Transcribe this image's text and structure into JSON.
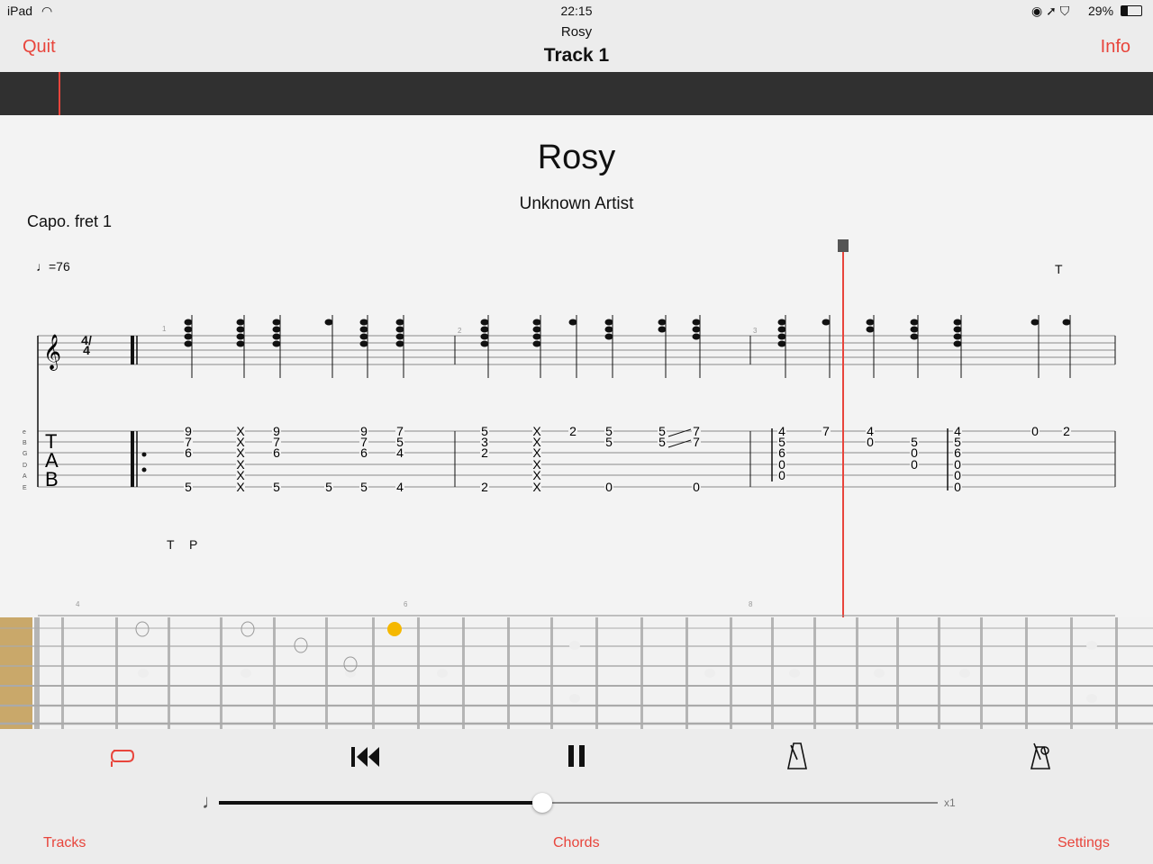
{
  "status_bar": {
    "device": "iPad",
    "time": "22:15",
    "battery": "29%"
  },
  "nav": {
    "quit": "Quit",
    "info": "Info",
    "subtitle": "Rosy",
    "title": "Track 1"
  },
  "score": {
    "title": "Rosy",
    "artist": "Unknown Artist",
    "capo": "Capo. fret 1",
    "tempo": "♩=76",
    "technique_marks": [
      "T",
      "T",
      "P"
    ],
    "measure_numbers": [
      "1",
      "2",
      "3",
      "4",
      "6",
      "8"
    ],
    "time_signature": "4/4",
    "tab_clef": [
      "T",
      "A",
      "B"
    ],
    "string_names": [
      "e",
      "B",
      "G",
      "D",
      "A",
      "E"
    ],
    "tab_columns": [
      [
        "9",
        "7",
        "6",
        "",
        "",
        "5"
      ],
      [
        "X",
        "X",
        "X",
        "X",
        "X",
        "X"
      ],
      [
        "9",
        "7",
        "6",
        "",
        "",
        "5"
      ],
      [
        "",
        "",
        "",
        "",
        "",
        "5"
      ],
      [
        "9",
        "7",
        "6",
        "",
        "",
        "5"
      ],
      [
        "7",
        "5",
        "4",
        "",
        "",
        "4"
      ],
      [
        "5",
        "3",
        "2",
        "",
        "",
        "2"
      ],
      [
        "X",
        "X",
        "X",
        "X",
        "X",
        "X"
      ],
      [
        "2",
        "",
        "",
        "",
        "",
        ""
      ],
      [
        "5",
        "5",
        "",
        "",
        "",
        "0"
      ],
      [
        "5",
        "5",
        "",
        "",
        "",
        ""
      ],
      [
        "7",
        "7",
        "",
        "",
        "",
        "0"
      ],
      [
        "4",
        "5",
        "6",
        "0",
        "0",
        ""
      ],
      [
        "7",
        "",
        "",
        "",
        "",
        ""
      ],
      [
        "4",
        "0",
        "",
        "",
        "",
        ""
      ],
      [
        "",
        "5",
        "0",
        "0",
        "",
        ""
      ],
      [
        "4",
        "5",
        "6",
        "0",
        "0",
        "0"
      ],
      [
        "0",
        "",
        "",
        "",
        "",
        ""
      ],
      [
        "2",
        "",
        "",
        "",
        "",
        ""
      ]
    ],
    "playhead_color": "#e8453c"
  },
  "fretboard": {
    "active_note_color": "#f5b800"
  },
  "controls": {
    "loop": "loop-icon",
    "rewind": "skip-back-icon",
    "pause": "pause-icon",
    "metronome": "metronome-icon",
    "count_in": "metronome-count-icon",
    "speed_label": "x1",
    "speed_fraction": 0.45
  },
  "tabs": {
    "tracks": "Tracks",
    "chords": "Chords",
    "settings": "Settings"
  },
  "colors": {
    "accent": "#e8453c",
    "timeline": "#303030"
  }
}
